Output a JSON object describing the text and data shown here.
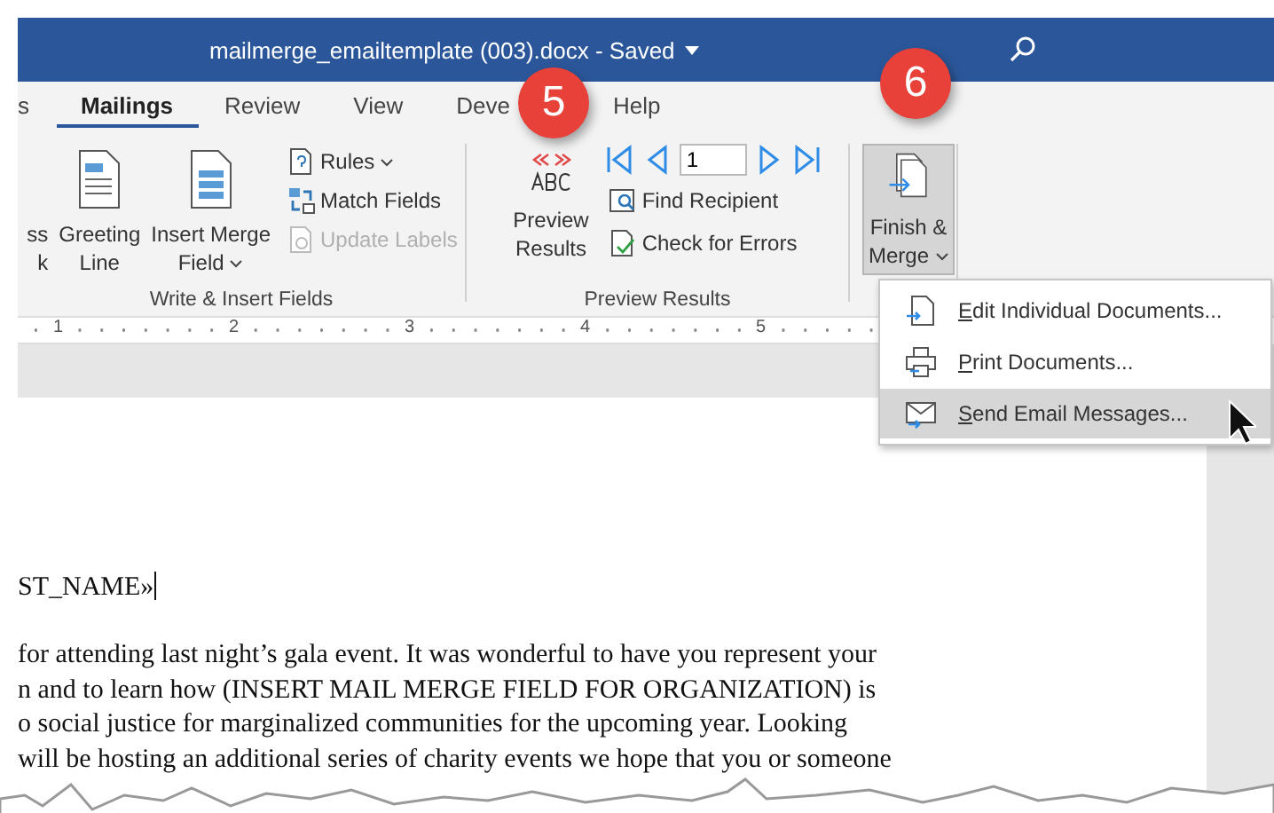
{
  "title_bar": {
    "title": "mailmerge_emailtemplate (003).docx  -  Saved"
  },
  "tabs": [
    {
      "label": "s",
      "selected": false
    },
    {
      "label": "Mailings",
      "selected": true
    },
    {
      "label": "Review",
      "selected": false
    },
    {
      "label": "View",
      "selected": false
    },
    {
      "label": "Deve",
      "selected": false
    },
    {
      "label": "Help",
      "selected": false
    }
  ],
  "write_insert_fields": {
    "label": "Write & Insert Fields",
    "large_buttons": [
      {
        "lines": [
          "ss",
          "k"
        ],
        "dropdown": false
      },
      {
        "lines": [
          "Greeting",
          "Line"
        ],
        "dropdown": false
      },
      {
        "lines": [
          "Insert Merge",
          "Field"
        ],
        "dropdown": true
      }
    ],
    "small_buttons": [
      {
        "label": "Rules",
        "dropdown": true,
        "disabled": false
      },
      {
        "label": "Match Fields",
        "dropdown": false,
        "disabled": false
      },
      {
        "label": "Update Labels",
        "dropdown": false,
        "disabled": true
      }
    ]
  },
  "preview_results": {
    "label": "Preview Results",
    "large_button": {
      "lines": [
        "Preview",
        "Results"
      ]
    },
    "record": "1",
    "small_buttons": [
      {
        "label": "Find Recipient"
      },
      {
        "label": "Check for Errors"
      }
    ]
  },
  "finish": {
    "button": {
      "lines": [
        "Finish &",
        "Merge"
      ],
      "dropdown": true,
      "pressed": true
    }
  },
  "finish_menu": [
    {
      "label": "Edit Individual Documents...",
      "selected": false
    },
    {
      "label": "Print Documents...",
      "selected": false
    },
    {
      "label": "Send Email Messages...",
      "selected": true
    }
  ],
  "ruler": [
    "1",
    "2",
    "3",
    "4",
    "5"
  ],
  "callouts": [
    {
      "number": "5"
    },
    {
      "number": "6"
    }
  ],
  "document": {
    "field_line": "ST_NAME»",
    "paragraph": [
      "for attending last night’s gala event. It was wonderful to have you represent your",
      "n and to learn how (INSERT MAIL MERGE FIELD FOR ORGANIZATION) is",
      "o social justice for marginalized communities for the upcoming year. Looking",
      "will be hosting an additional series of charity events we hope that you or someone"
    ]
  }
}
